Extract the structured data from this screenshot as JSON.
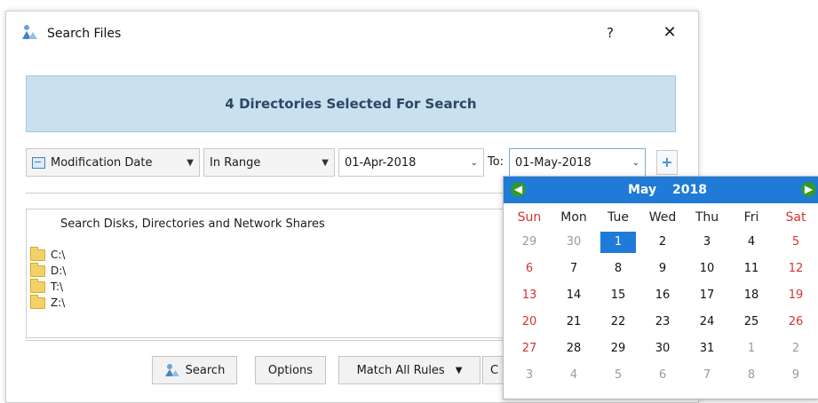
{
  "dialog": {
    "title": "Search Files",
    "help_label": "?",
    "close_label": "✕",
    "banner": "4 Directories Selected For Search"
  },
  "filter": {
    "field": "Modification Date",
    "operator": "In Range",
    "date_from": "01-Apr-2018",
    "to_label": "To:",
    "date_to": "01-May-2018",
    "add_label": "+"
  },
  "directories": {
    "header": "Search Disks, Directories and Network Shares",
    "items": [
      "C:\\",
      "D:\\",
      "T:\\",
      "Z:\\"
    ]
  },
  "buttons": {
    "search": "Search",
    "options": "Options",
    "match": "Match All Rules",
    "cancel": "C"
  },
  "calendar": {
    "month": "May",
    "year": "2018",
    "days_of_week": [
      "Sun",
      "Mon",
      "Tue",
      "Wed",
      "Thu",
      "Fri",
      "Sat"
    ],
    "weeks": [
      [
        "29",
        "30",
        "1",
        "2",
        "3",
        "4",
        "5"
      ],
      [
        "6",
        "7",
        "8",
        "9",
        "10",
        "11",
        "12"
      ],
      [
        "13",
        "14",
        "15",
        "16",
        "17",
        "18",
        "19"
      ],
      [
        "20",
        "21",
        "22",
        "23",
        "24",
        "25",
        "26"
      ],
      [
        "27",
        "28",
        "29",
        "30",
        "31",
        "1",
        "2"
      ],
      [
        "3",
        "4",
        "5",
        "6",
        "7",
        "8",
        "9"
      ]
    ],
    "other_month_cells": [
      [
        0,
        0
      ],
      [
        0,
        1
      ],
      [
        4,
        5
      ],
      [
        4,
        6
      ],
      [
        5,
        0
      ],
      [
        5,
        1
      ],
      [
        5,
        2
      ],
      [
        5,
        3
      ],
      [
        5,
        4
      ],
      [
        5,
        5
      ],
      [
        5,
        6
      ]
    ],
    "selected_cell": [
      0,
      2
    ],
    "colors": {
      "header": "#1f7ad8",
      "weekend": "#d43333",
      "nav": "#2f9a2f"
    }
  }
}
